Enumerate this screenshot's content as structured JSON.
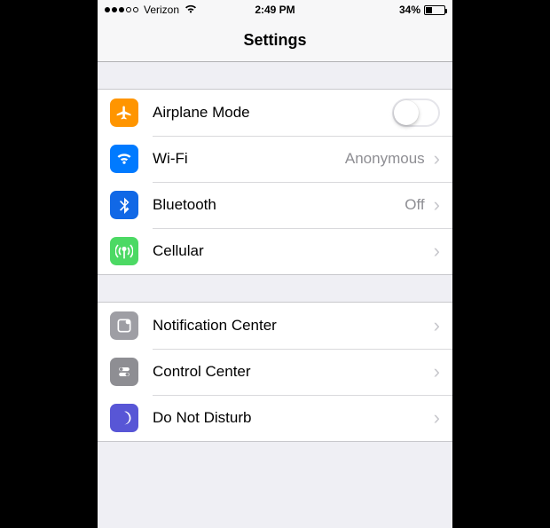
{
  "statusbar": {
    "carrier": "Verizon",
    "time": "2:49 PM",
    "battery_pct": "34%"
  },
  "nav": {
    "title": "Settings"
  },
  "rows": {
    "airplane": {
      "label": "Airplane Mode",
      "toggle": "off"
    },
    "wifi": {
      "label": "Wi-Fi",
      "detail": "Anonymous"
    },
    "bluetooth": {
      "label": "Bluetooth",
      "detail": "Off"
    },
    "cellular": {
      "label": "Cellular"
    },
    "notif": {
      "label": "Notification Center"
    },
    "control": {
      "label": "Control Center"
    },
    "dnd": {
      "label": "Do Not Disturb"
    }
  }
}
